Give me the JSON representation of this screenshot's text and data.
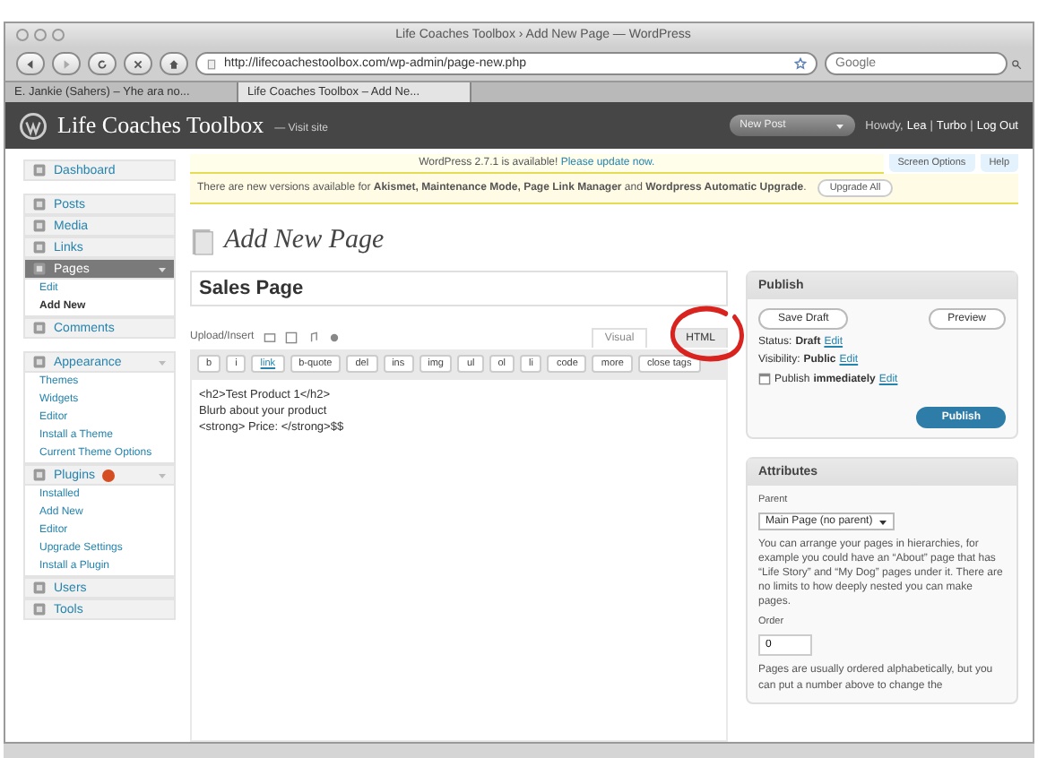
{
  "window": {
    "title": "Life Coaches Toolbox › Add New Page — WordPress"
  },
  "address_bar": {
    "url": "http://lifecoachestoolbox.com/wp-admin/page-new.php"
  },
  "search": {
    "placeholder": "Google"
  },
  "browser_tabs": [
    {
      "label": "E. Jankie (Sahers) – Yhe ara no...",
      "selected": false
    },
    {
      "label": "Life Coaches Toolbox – Add Ne...",
      "selected": true
    }
  ],
  "header": {
    "site_name": "Life Coaches Toolbox",
    "visit_site": "— Visit site",
    "new_post": "New Post",
    "howdy": "Howdy,",
    "user": "Lea",
    "separator": "|",
    "turbo": "Turbo",
    "log_out": "Log Out"
  },
  "screen_options": "Screen Options",
  "help": "Help",
  "update_nag": {
    "text": "WordPress 2.7.1 is available!",
    "link": "Please update now."
  },
  "plugin_notice": {
    "text": "There are new versions available for **Akismet, Maintenance Mode, Page Link Manager** and **Wordpress Automatic Upgrade**.",
    "button": "Upgrade All"
  },
  "sidebar": [
    {
      "items": [
        {
          "label": "Dashboard",
          "selected": false
        }
      ]
    },
    {
      "items": [
        {
          "label": "Posts",
          "selected": false
        },
        {
          "label": "Media",
          "selected": false
        },
        {
          "label": "Links",
          "selected": false
        },
        {
          "label": "Pages",
          "selected": true,
          "expanded": true,
          "children": [
            {
              "label": "Edit",
              "selected": false
            },
            {
              "label": "Add New",
              "selected": true
            }
          ]
        },
        {
          "label": "Comments",
          "selected": false
        }
      ]
    },
    {
      "items": [
        {
          "label": "Appearance",
          "selected": false,
          "expanded": true,
          "children": [
            {
              "label": "Themes",
              "selected": false
            },
            {
              "label": "Widgets",
              "selected": false
            },
            {
              "label": "Editor",
              "selected": false
            },
            {
              "label": "Install a Theme",
              "selected": false
            },
            {
              "label": "Current Theme Options",
              "selected": false
            }
          ]
        },
        {
          "label": "Plugins",
          "selected": false,
          "expanded": true,
          "has_update": true,
          "children": [
            {
              "label": "Installed",
              "selected": false
            },
            {
              "label": "Add New",
              "selected": false
            },
            {
              "label": "Editor",
              "selected": false
            },
            {
              "label": "Upgrade Settings",
              "selected": false
            },
            {
              "label": "Install a Plugin",
              "selected": false
            }
          ]
        },
        {
          "label": "Users",
          "selected": false
        },
        {
          "label": "Tools",
          "selected": false
        }
      ]
    }
  ],
  "page_heading": "Add New Page",
  "post_title": "Sales Page",
  "upload_insert": "Upload/Insert",
  "editor_tabs": [
    {
      "label": "Visual",
      "selected": false
    },
    {
      "label": "HTML",
      "selected": true
    }
  ],
  "quicktags": [
    "b",
    "i",
    "link",
    "b-quote",
    "del",
    "ins",
    "img",
    "ul",
    "ol",
    "li",
    "code",
    "more",
    "close tags"
  ],
  "content": [
    "<h2>Test Product 1</h2>",
    "Blurb about your product",
    "<strong> Price: </strong>$$"
  ],
  "publish_box": {
    "title": "Publish",
    "save_draft": "Save Draft",
    "preview": "Preview",
    "rows": [
      {
        "label": "Status:",
        "value": "Draft",
        "link": "Edit",
        "kind": "text"
      },
      {
        "label": "Visibility:",
        "value": "Public",
        "link": "Edit",
        "kind": "text"
      },
      {
        "label": "Publish",
        "value": "immediately",
        "link": "Edit",
        "kind": "calendar"
      }
    ],
    "publish": "Publish"
  },
  "attributes_box": {
    "title": "Attributes",
    "parent_label": "Parent",
    "parent_value": "Main Page (no parent)",
    "parent_help": "You can arrange your pages in hierarchies, for example you could have an “About” page that has “Life Story” and “My Dog” pages under it. There are no limits to how deeply nested you can make pages.",
    "order_label": "Order",
    "order_value": "0",
    "order_help": "Pages are usually ordered alphabetically, but you can put a number above to change the"
  }
}
